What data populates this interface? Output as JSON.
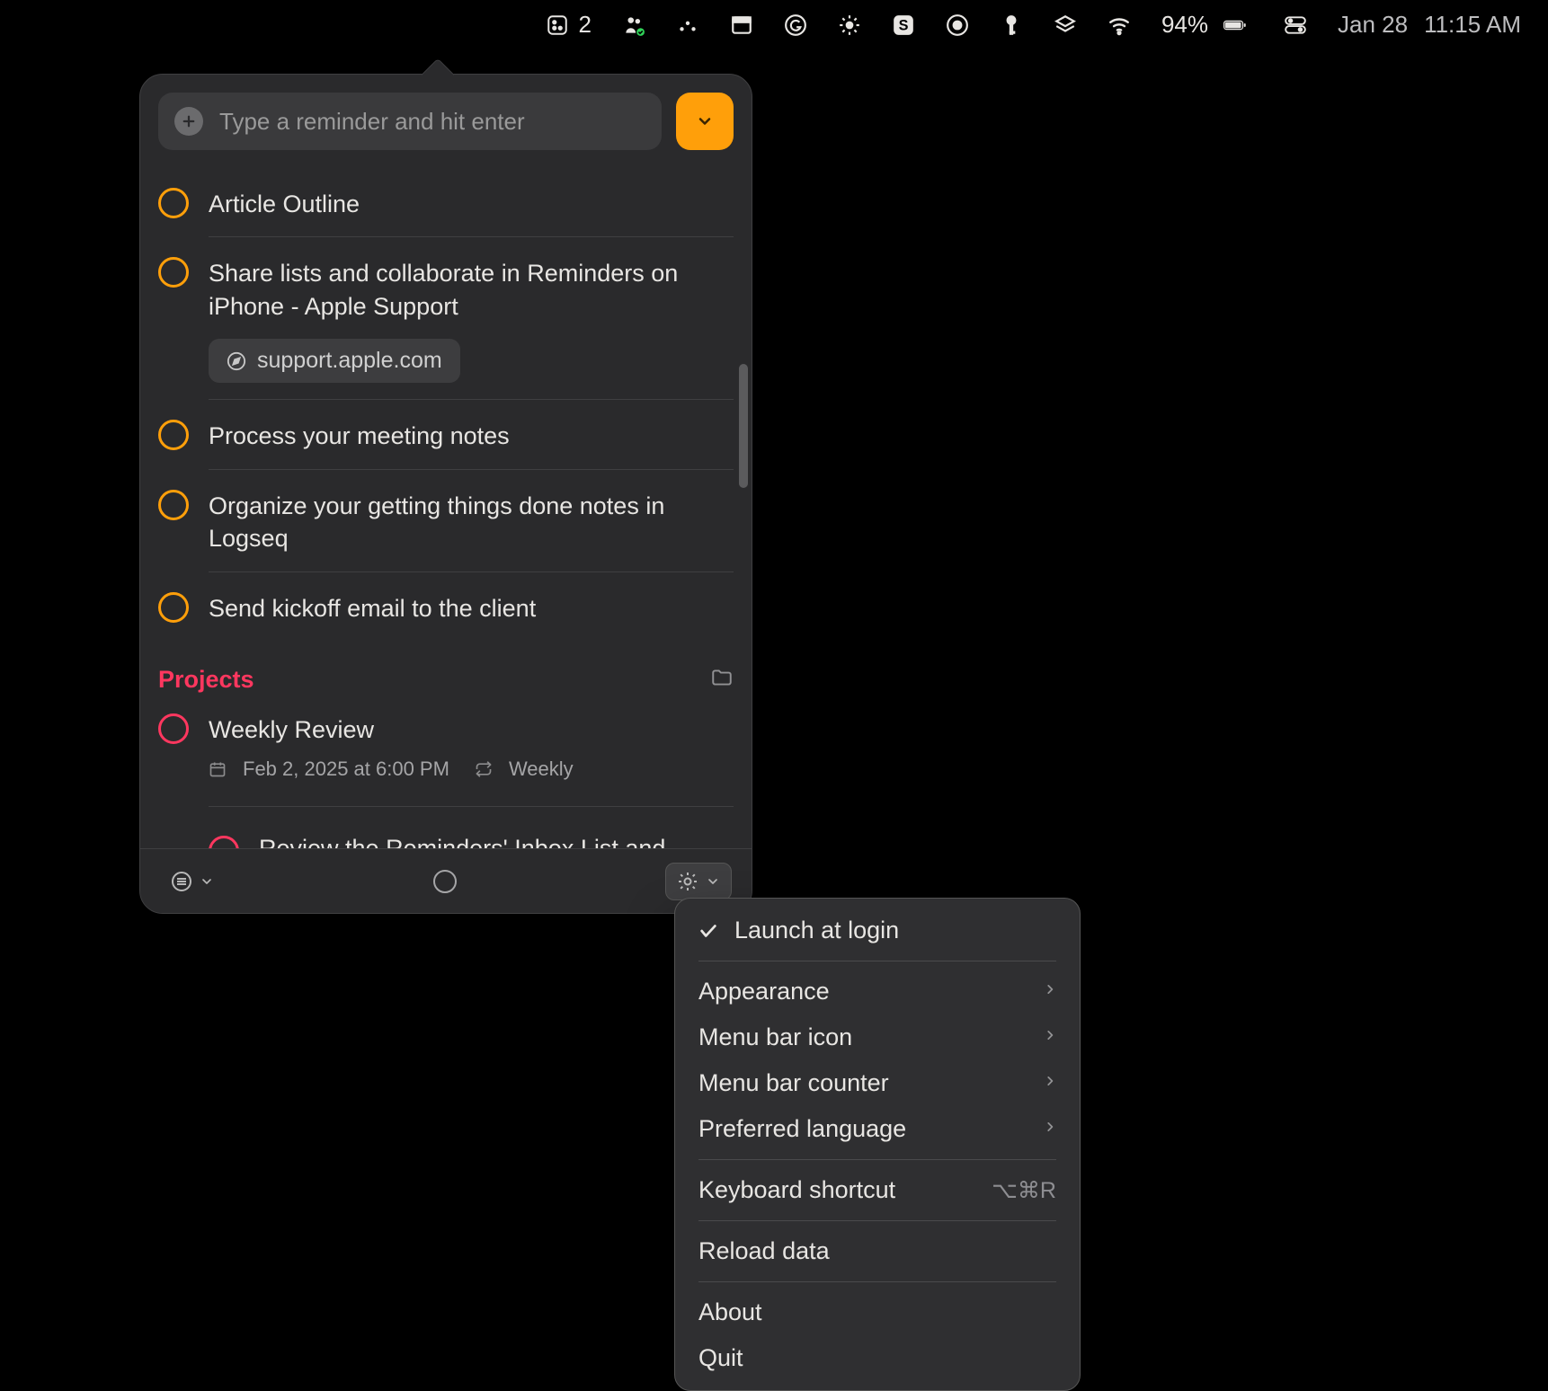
{
  "menubar": {
    "badge_count": "2",
    "battery_pct": "94%",
    "date_str": "Jan 28",
    "time_str": "11:15 AM"
  },
  "panel": {
    "input_placeholder": "Type a reminder and hit enter"
  },
  "reminders": [
    {
      "title": "Article Outline"
    },
    {
      "title": "Share lists and collaborate in Reminders on iPhone - Apple Support",
      "link_label": "support.apple.com"
    },
    {
      "title": "Process your meeting notes"
    },
    {
      "title": "Organize your getting things done notes in Logseq"
    },
    {
      "title": "Send kickoff email to the client"
    }
  ],
  "section": {
    "title": "Projects"
  },
  "project_item": {
    "title": "Weekly Review",
    "date": "Feb 2, 2025 at 6:00 PM",
    "repeat": "Weekly",
    "sub_title": "Review the Reminders' Inbox List and Schedule Tasks"
  },
  "ctx": {
    "launch_at_login": "Launch at login",
    "appearance": "Appearance",
    "menu_bar_icon": "Menu bar icon",
    "menu_bar_counter": "Menu bar counter",
    "preferred_language": "Preferred language",
    "keyboard_shortcut": "Keyboard shortcut",
    "keyboard_shortcut_key": "⌥⌘R",
    "reload_data": "Reload data",
    "about": "About",
    "quit": "Quit"
  }
}
